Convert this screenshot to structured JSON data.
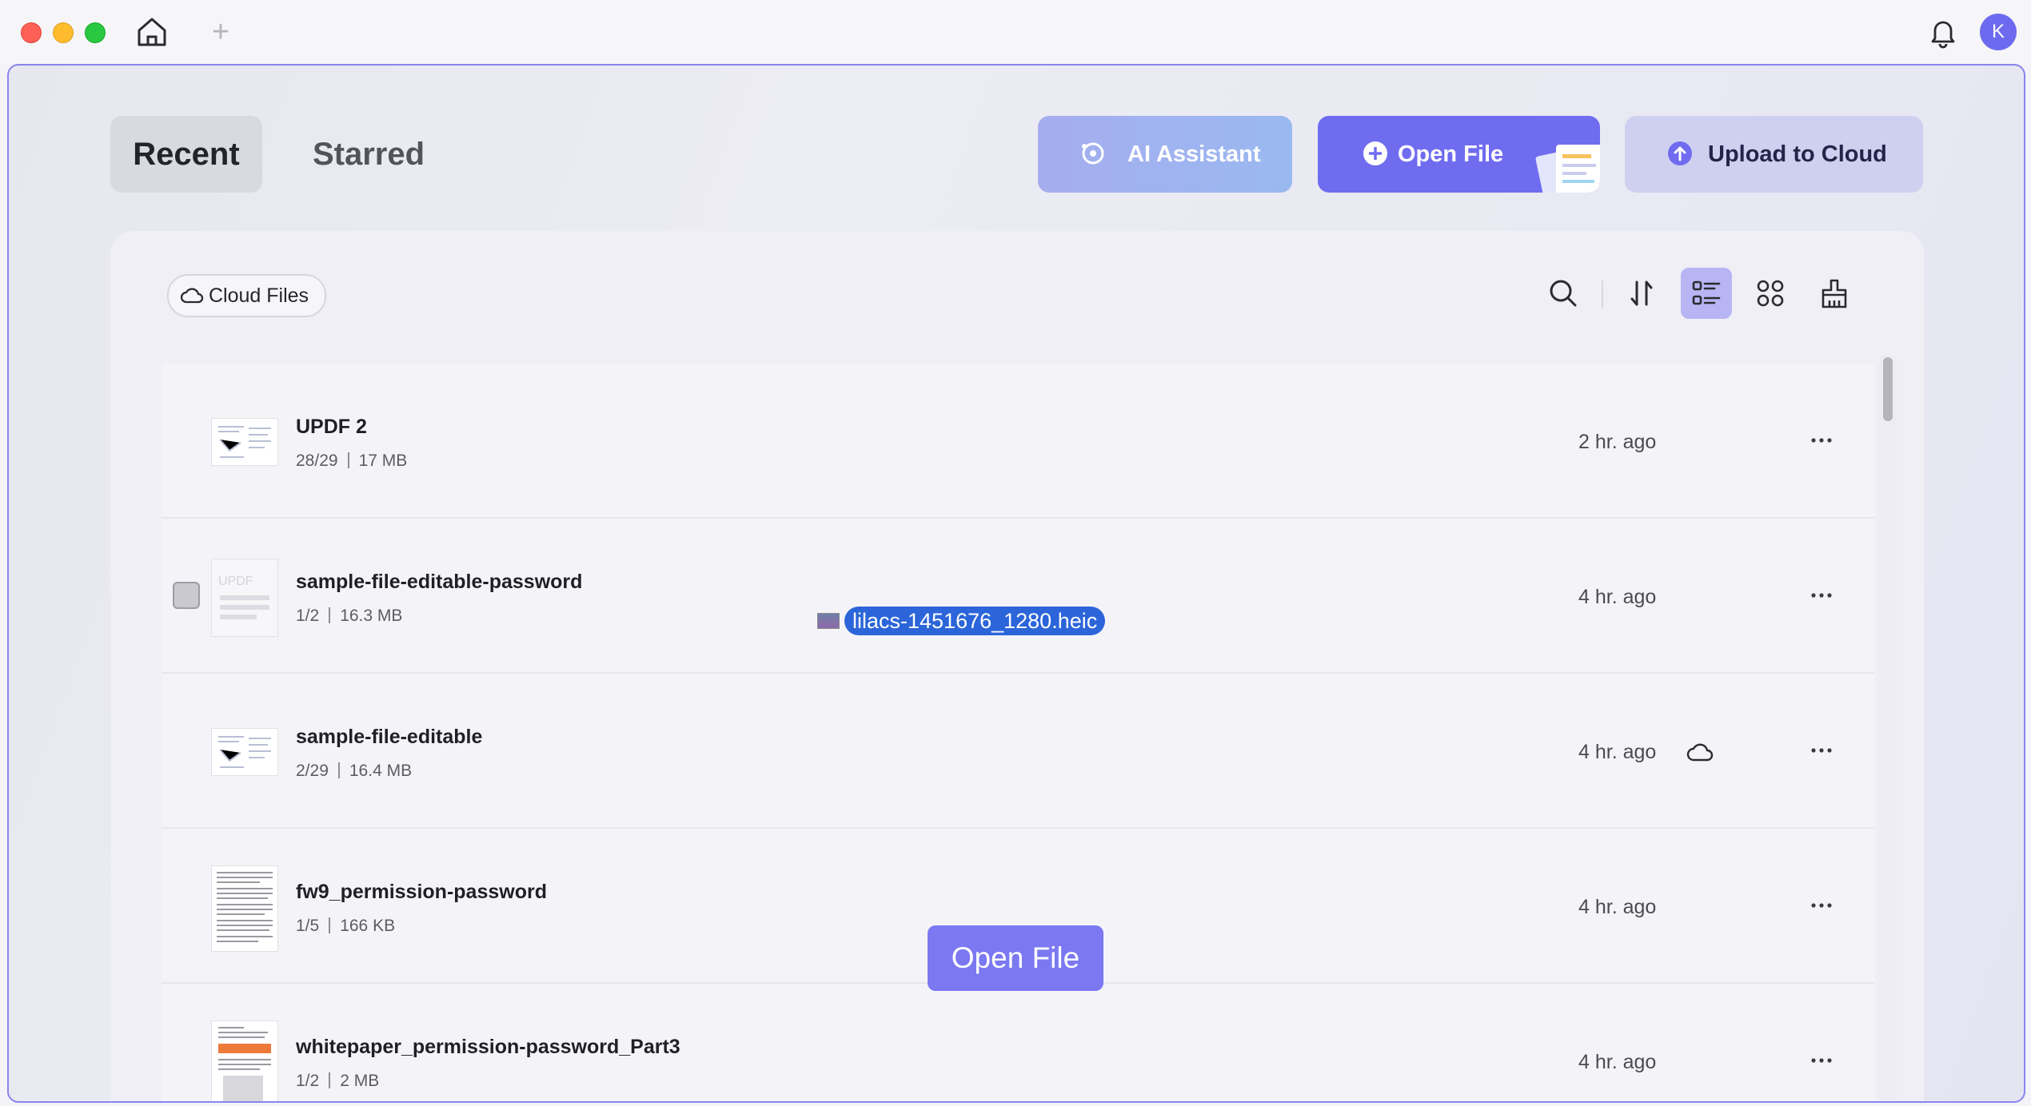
{
  "titlebar": {
    "new_tab": "+",
    "avatar_initial": "K"
  },
  "tabs": {
    "recent": "Recent",
    "starred": "Starred"
  },
  "actions": {
    "ai_assistant": "AI Assistant",
    "open_file": "Open File",
    "upload_to_cloud": "Upload to Cloud"
  },
  "panel": {
    "cloud_files": "Cloud Files"
  },
  "files": [
    {
      "name": "UPDF 2",
      "pages": "28/29",
      "size": "17 MB",
      "time": "2 hr. ago"
    },
    {
      "name": "sample-file-editable-password",
      "pages": "1/2",
      "size": "16.3 MB",
      "time": "4 hr. ago"
    },
    {
      "name": "sample-file-editable",
      "pages": "2/29",
      "size": "16.4 MB",
      "time": "4 hr. ago"
    },
    {
      "name": "fw9_permission-password",
      "pages": "1/5",
      "size": "166 KB",
      "time": "4 hr. ago"
    },
    {
      "name": "whitepaper_permission-password_Part3",
      "pages": "1/2",
      "size": "2 MB",
      "time": "4 hr. ago"
    }
  ],
  "drag": {
    "filename": "lilacs-1451676_1280.heic",
    "drop_label": "Open File"
  },
  "colors": {
    "accent": "#6f6cf0",
    "selected_tool": "#b7b5f3",
    "window_border": "#8a84ee"
  }
}
